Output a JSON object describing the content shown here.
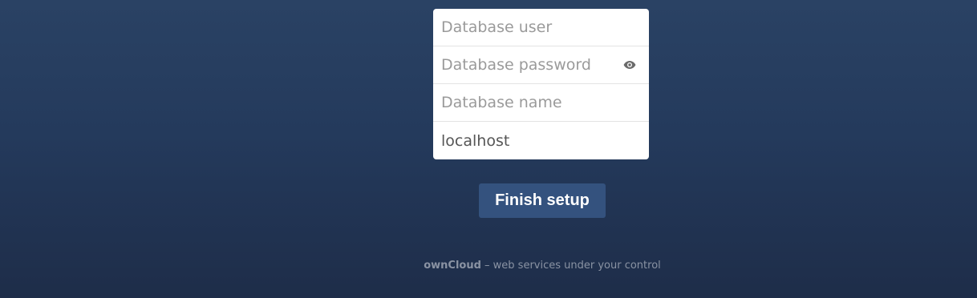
{
  "form": {
    "db_user_placeholder": "Database user",
    "db_password_placeholder": "Database password",
    "db_name_placeholder": "Database name",
    "db_host_value": "localhost",
    "show_password_icon": "eye-icon"
  },
  "actions": {
    "finish_label": "Finish setup"
  },
  "footer": {
    "brand": "ownCloud",
    "tagline": " – web services under your control"
  },
  "colors": {
    "background_top": "#2a4264",
    "background_bottom": "#1e2d49",
    "button": "#34527e"
  }
}
